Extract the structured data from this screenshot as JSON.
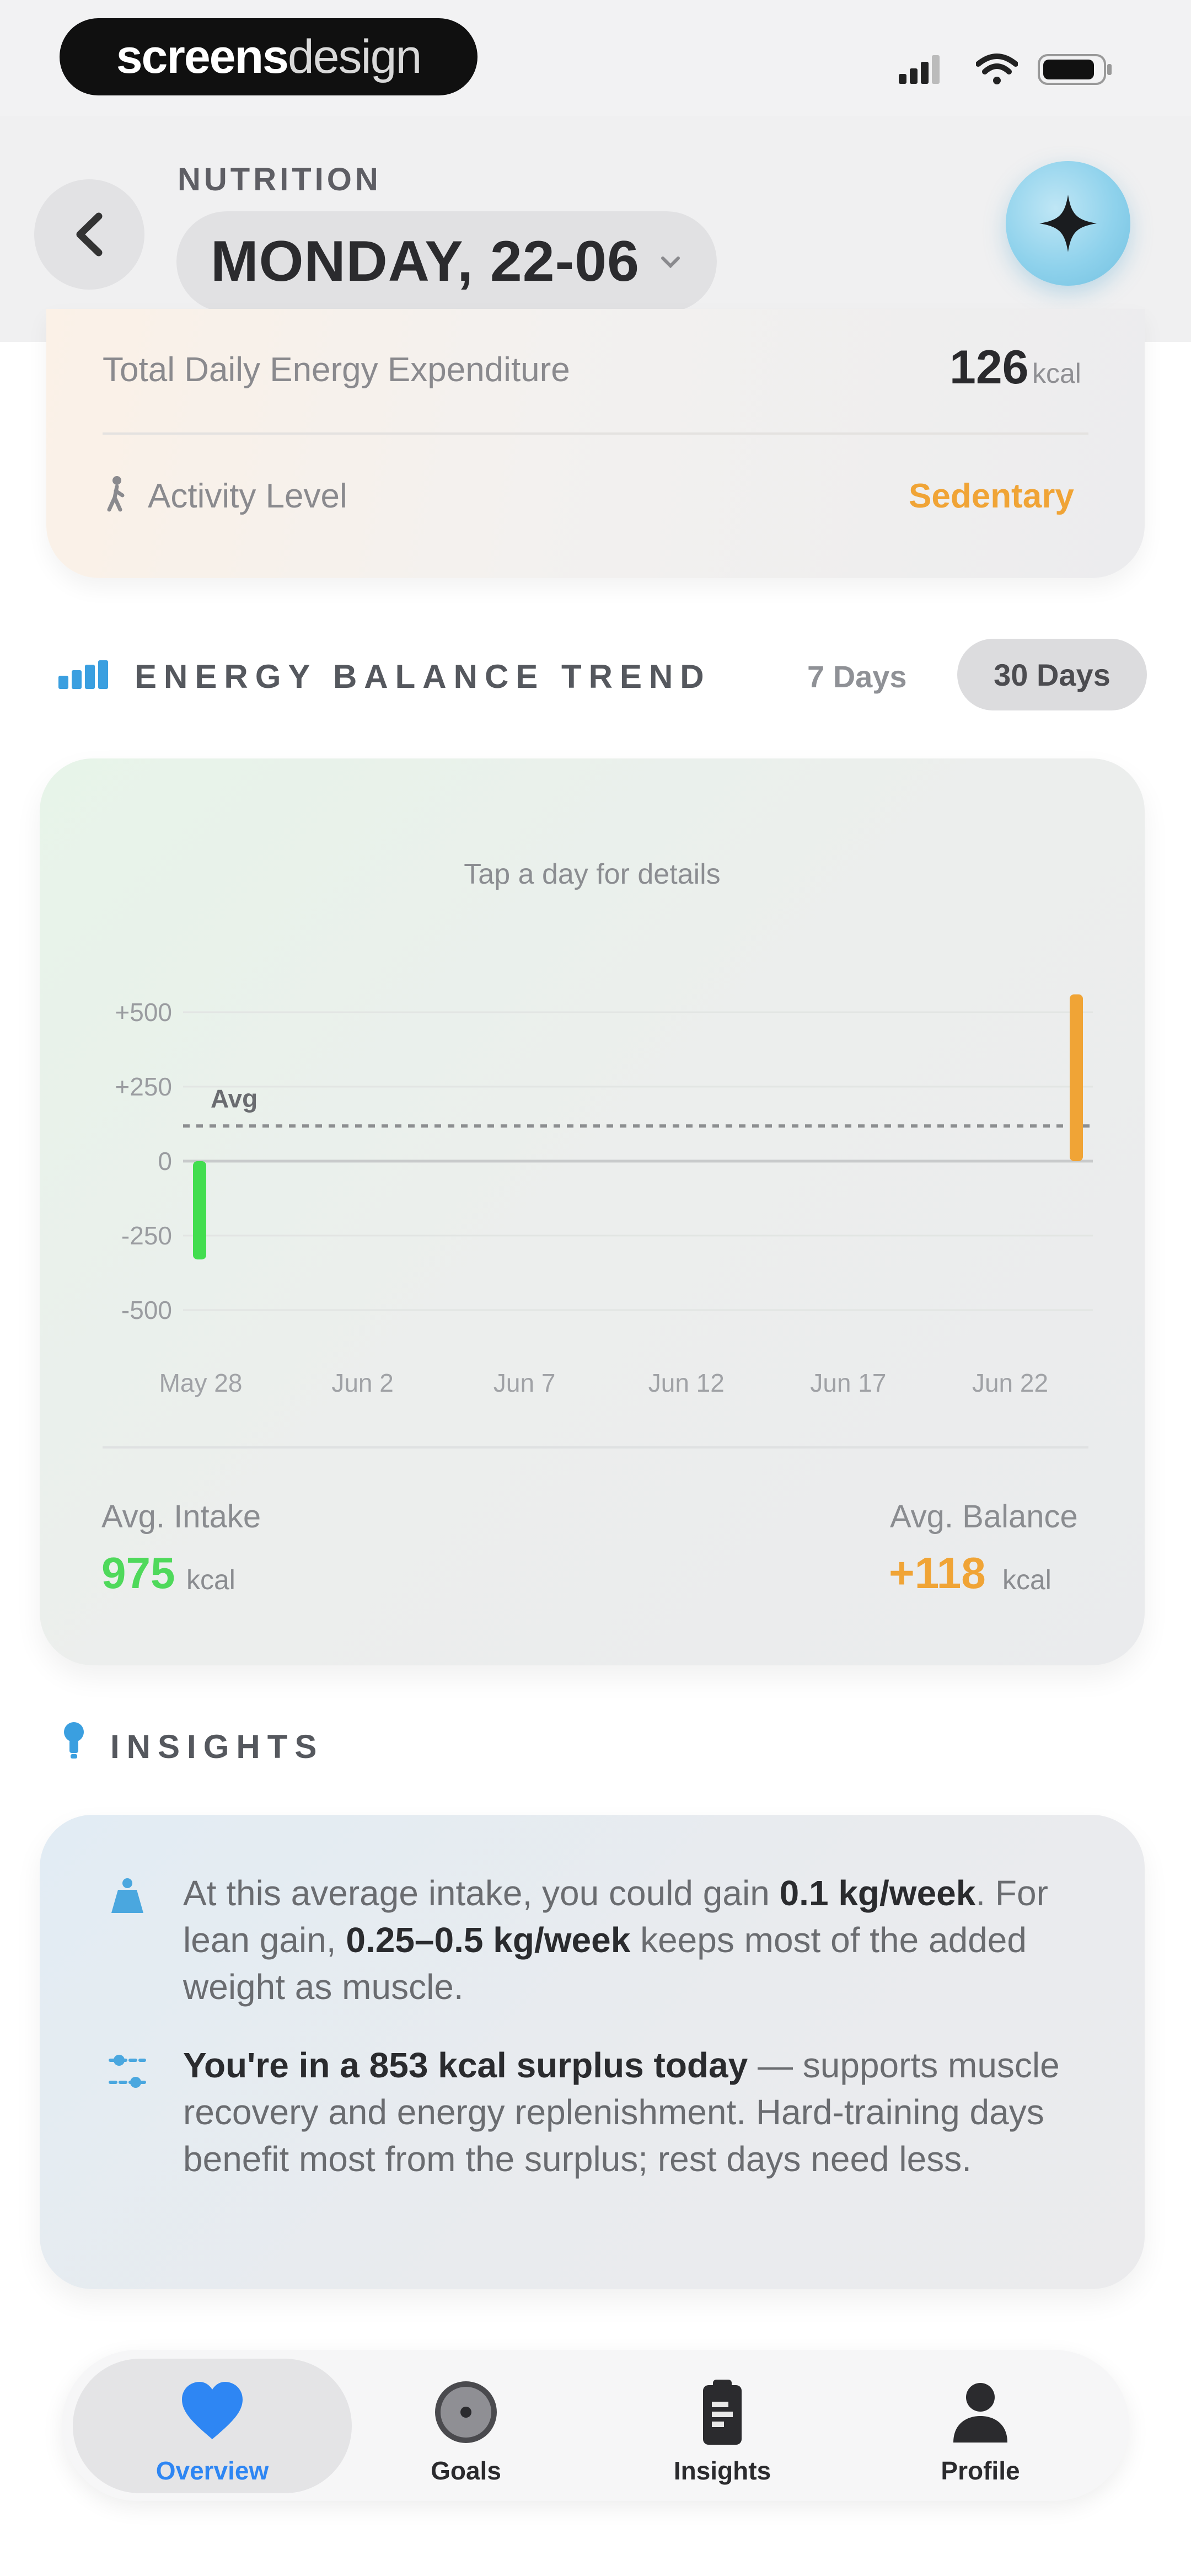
{
  "watermark": {
    "bold": "screens",
    "light": "design"
  },
  "header": {
    "section_label": "NUTRITION",
    "date": "MONDAY, 22-06"
  },
  "metrics": {
    "tdee_label": "Total Daily Energy Expenditure",
    "tdee_value": "126",
    "tdee_unit": "kcal",
    "activity_label": "Activity Level",
    "activity_value": "Sedentary"
  },
  "trend": {
    "title": "ENERGY BALANCE TREND",
    "tabs": [
      "7 Days",
      "30 Days"
    ],
    "selected_tab": "30 Days",
    "hint": "Tap a day for details",
    "avg_intake_label": "Avg. Intake",
    "avg_intake_value": "975",
    "avg_intake_unit": "kcal",
    "avg_balance_label": "Avg. Balance",
    "avg_balance_value": "+118",
    "avg_balance_unit": "kcal"
  },
  "chart_data": {
    "type": "bar",
    "x_tick_labels": [
      "May 28",
      "Jun 2",
      "Jun 7",
      "Jun 12",
      "Jun 17",
      "Jun 22"
    ],
    "y_tick_labels": [
      "+500",
      "+250",
      "0",
      "-250",
      "-500"
    ],
    "y_ticks": [
      500,
      250,
      0,
      -250,
      -500
    ],
    "ylim": [
      -500,
      500
    ],
    "x_range": [
      "2026-05-24",
      "2026-06-22"
    ],
    "bars": [
      {
        "x": "2026-05-24",
        "value": -330,
        "color": "#43dd4f"
      },
      {
        "x": "2026-06-22",
        "value": 560,
        "color": "#f0a436"
      }
    ],
    "average": {
      "label": "Avg",
      "value": 118
    },
    "grid": true,
    "legend": "none"
  },
  "insights": {
    "title": "INSIGHTS",
    "items": [
      {
        "icon": "scale-icon",
        "parts": [
          {
            "text": "At this average intake, you could gain ",
            "bold": false
          },
          {
            "text": "0.1 kg/week",
            "bold": true
          },
          {
            "text": ". For lean gain, ",
            "bold": false
          },
          {
            "text": "0.25–0.5 kg/week",
            "bold": true
          },
          {
            "text": " keeps most of the added weight as muscle.",
            "bold": false
          }
        ]
      },
      {
        "icon": "sliders-icon",
        "parts": [
          {
            "text": "You're in a 853 kcal surplus today",
            "bold": true
          },
          {
            "text": " — supports muscle recovery and energy replenishment. Hard-training days benefit most from the surplus; rest days need less.",
            "bold": false
          }
        ]
      }
    ]
  },
  "tab_bar": {
    "items": [
      {
        "label": "Overview",
        "icon": "heart-icon",
        "active": true
      },
      {
        "label": "Goals",
        "icon": "target-icon",
        "active": false
      },
      {
        "label": "Insights",
        "icon": "clipboard-icon",
        "active": false
      },
      {
        "label": "Profile",
        "icon": "person-icon",
        "active": false
      }
    ]
  },
  "colors": {
    "accent_blue": "#2e86f3",
    "positive_green": "#4fd95b",
    "surplus_orange": "#f0a436"
  }
}
